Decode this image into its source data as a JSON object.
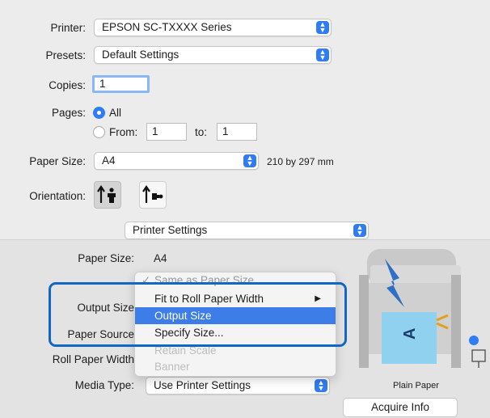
{
  "printer": {
    "label": "Printer:",
    "value": "EPSON SC-TXXXX Series"
  },
  "presets": {
    "label": "Presets:",
    "value": "Default Settings"
  },
  "copies": {
    "label": "Copies:",
    "value": "1"
  },
  "pages": {
    "label": "Pages:",
    "all_label": "All",
    "from_label": "From:",
    "from_value": "1",
    "to_label": "to:",
    "to_value": "1"
  },
  "paper_size": {
    "label": "Paper Size:",
    "value": "A4",
    "dimensions": "210 by 297 mm"
  },
  "orientation": {
    "label": "Orientation:"
  },
  "section_popup": {
    "value": "Printer Settings"
  },
  "printer_settings": {
    "paper_size_label": "Paper Size:",
    "paper_size_value": "A4",
    "output_size_label": "Output Size",
    "paper_source_label": "Paper Source",
    "roll_width_label": "Roll Paper Width",
    "media_type_label": "Media Type:",
    "media_type_value": "Use Printer Settings",
    "media_caption": "Plain Paper",
    "acquire_info_label": "Acquire Info"
  },
  "menu": {
    "items": [
      {
        "label": "Same as Paper Size",
        "check": "✓"
      },
      {
        "label": "Fit to Roll Paper Width",
        "arrow": "▶"
      },
      {
        "label": "Output Size"
      },
      {
        "label": "Specify Size..."
      },
      {
        "label": "Retain Scale"
      },
      {
        "label": "Banner"
      }
    ]
  },
  "colors": {
    "accent": "#2f7cf6",
    "highlight": "#3d7de8",
    "callout": "#1367c4"
  }
}
